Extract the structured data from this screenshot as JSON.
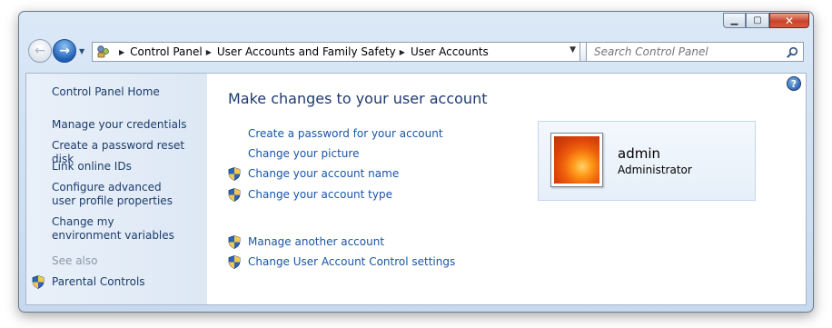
{
  "window": {
    "caption": {
      "minimize": "▁",
      "maximize": "▢",
      "close": "✕"
    }
  },
  "navbar": {
    "back_icon": "back-arrow-icon",
    "forward_icon": "forward-arrow-icon",
    "breadcrumbs": [
      "Control Panel",
      "User Accounts and Family Safety",
      "User Accounts"
    ],
    "search_placeholder": "Search Control Panel"
  },
  "sidebar": {
    "home": "Control Panel Home",
    "links": [
      "Manage your credentials",
      "Create a password reset disk",
      "Link online IDs",
      "Configure advanced user profile properties",
      "Change my environment variables"
    ],
    "see_also_label": "See also",
    "see_also_links": [
      "Parental Controls"
    ]
  },
  "main": {
    "title": "Make changes to your user account",
    "tasks_group1": [
      {
        "label": "Create a password for your account",
        "shield": false
      },
      {
        "label": "Change your picture",
        "shield": false
      },
      {
        "label": "Change your account name",
        "shield": true
      },
      {
        "label": "Change your account type",
        "shield": true
      }
    ],
    "tasks_group2": [
      {
        "label": "Manage another account",
        "shield": true
      },
      {
        "label": "Change User Account Control settings",
        "shield": true
      }
    ],
    "help": "?"
  },
  "user": {
    "name": "admin",
    "role": "Administrator"
  },
  "colors": {
    "link": "#1a55a8",
    "sidebar_link": "#1b3c6a",
    "title": "#1e3b6e",
    "see_also": "#8a98aa"
  }
}
